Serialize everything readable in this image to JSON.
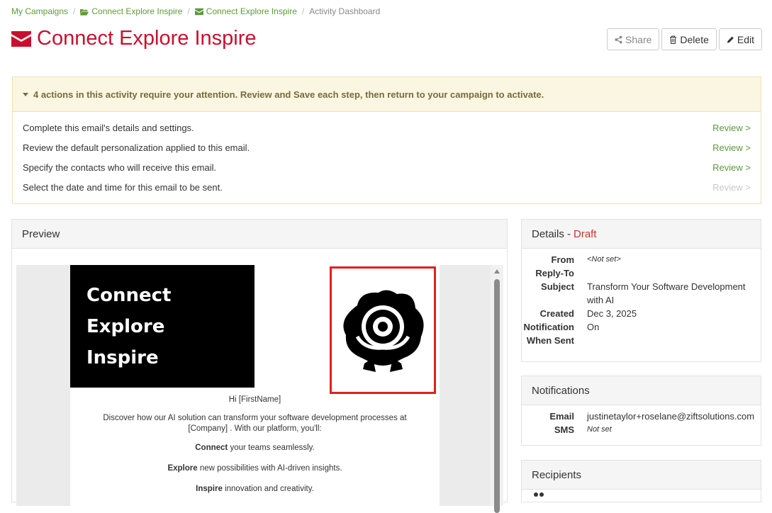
{
  "breadcrumb": {
    "items": [
      {
        "label": "My Campaigns"
      },
      {
        "label": "Connect Explore Inspire",
        "icon": "folder-open-icon"
      },
      {
        "label": "Connect Explore Inspire",
        "icon": "envelope-icon"
      }
    ],
    "current": "Activity Dashboard"
  },
  "page": {
    "title": "Connect Explore Inspire",
    "title_icon": "envelope-icon",
    "accent_color": "#c8102e"
  },
  "actions": {
    "share_label": "Share",
    "delete_label": "Delete",
    "edit_label": "Edit"
  },
  "attention": {
    "heading": "4 actions in this activity require your attention. Review and Save each step, then return to your campaign to activate.",
    "tasks": [
      {
        "text": "Complete this email's details and settings.",
        "link": "Review >",
        "enabled": true
      },
      {
        "text": "Review the default personalization applied to this email.",
        "link": "Review >",
        "enabled": true
      },
      {
        "text": "Specify the contacts who will receive this email.",
        "link": "Review >",
        "enabled": true
      },
      {
        "text": "Select the date and time for this email to be sent.",
        "link": "Review >",
        "enabled": false
      }
    ]
  },
  "preview": {
    "heading": "Preview",
    "hero_lines": [
      "Connect",
      "Explore",
      "Inspire"
    ],
    "greeting": "Hi [FirstName]",
    "intro": "Discover how our AI solution can transform your software development processes at [Company] . With our platform, you'll:",
    "bullets": [
      {
        "bold": "Connect",
        "rest": " your teams seamlessly."
      },
      {
        "bold": "Explore",
        "rest": " new possibilities with AI-driven insights."
      },
      {
        "bold": "Inspire",
        "rest": " innovation and creativity."
      }
    ]
  },
  "details": {
    "heading": "Details -",
    "status": "Draft",
    "rows": [
      {
        "label": "From",
        "value": "<Not set>",
        "italic": true
      },
      {
        "label": "Reply-To",
        "value": ""
      },
      {
        "label": "Subject",
        "value": "Transform Your Software Development with AI"
      },
      {
        "label": "Created",
        "value": "Dec 3, 2025"
      },
      {
        "label": "Notification When Sent",
        "value": "On"
      }
    ]
  },
  "notifications": {
    "heading": "Notifications",
    "email_label": "Email",
    "email_value": "justinetaylor+roselane@ziftsolutions.com",
    "sms_label": "SMS",
    "sms_value": "Not set"
  },
  "recipients": {
    "heading": "Recipients"
  }
}
